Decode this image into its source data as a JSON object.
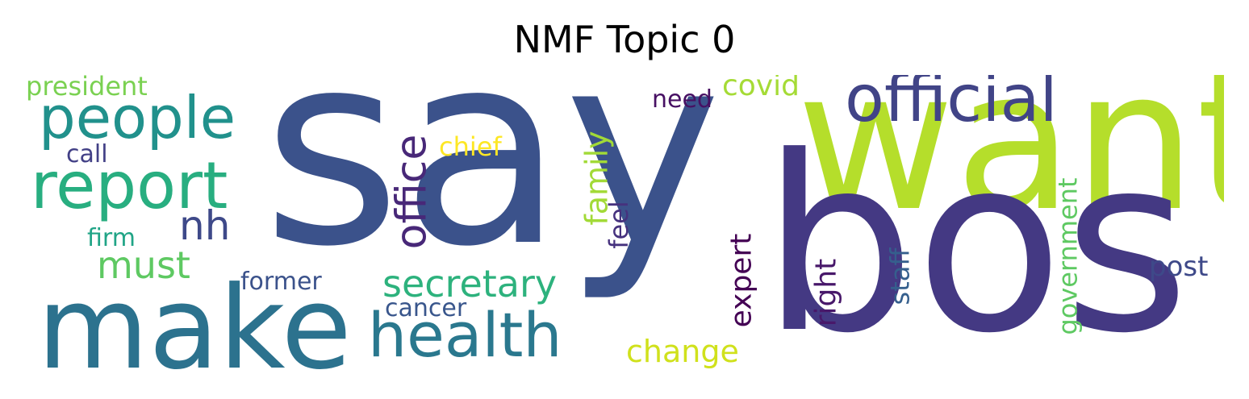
{
  "title": "NMF Topic 0",
  "words": [
    {
      "text": "say",
      "color": "#3b528b",
      "rotated": false
    },
    {
      "text": "want",
      "color": "#b5de2b",
      "rotated": false
    },
    {
      "text": "bos",
      "color": "#443983",
      "rotated": false
    },
    {
      "text": "make",
      "color": "#2c728e",
      "rotated": false
    },
    {
      "text": "official",
      "color": "#414487",
      "rotated": false
    },
    {
      "text": "people",
      "color": "#21918c",
      "rotated": false
    },
    {
      "text": "report",
      "color": "#28ae80",
      "rotated": false
    },
    {
      "text": "health",
      "color": "#2a788e",
      "rotated": false
    },
    {
      "text": "office",
      "color": "#482878",
      "rotated": true
    },
    {
      "text": "secretary",
      "color": "#2db27d",
      "rotated": false
    },
    {
      "text": "must",
      "color": "#5ec962",
      "rotated": false
    },
    {
      "text": "nh",
      "color": "#3e4989",
      "rotated": false
    },
    {
      "text": "president",
      "color": "#7ad151",
      "rotated": false
    },
    {
      "text": "call",
      "color": "#424086",
      "rotated": false
    },
    {
      "text": "firm",
      "color": "#20a486",
      "rotated": false
    },
    {
      "text": "chief",
      "color": "#fde725",
      "rotated": false
    },
    {
      "text": "family",
      "color": "#a2da37",
      "rotated": true
    },
    {
      "text": "feel",
      "color": "#46327e",
      "rotated": true
    },
    {
      "text": "need",
      "color": "#471063",
      "rotated": false
    },
    {
      "text": "covid",
      "color": "#a5db36",
      "rotated": false
    },
    {
      "text": "former",
      "color": "#3b528b",
      "rotated": false
    },
    {
      "text": "cancer",
      "color": "#39568c",
      "rotated": false
    },
    {
      "text": "change",
      "color": "#d0e11c",
      "rotated": false
    },
    {
      "text": "expert",
      "color": "#440154",
      "rotated": true
    },
    {
      "text": "right",
      "color": "#48186a",
      "rotated": true
    },
    {
      "text": "staff",
      "color": "#355f8d",
      "rotated": true
    },
    {
      "text": "government",
      "color": "#5ec962",
      "rotated": true
    },
    {
      "text": "post",
      "color": "#3e4989",
      "rotated": false
    }
  ]
}
